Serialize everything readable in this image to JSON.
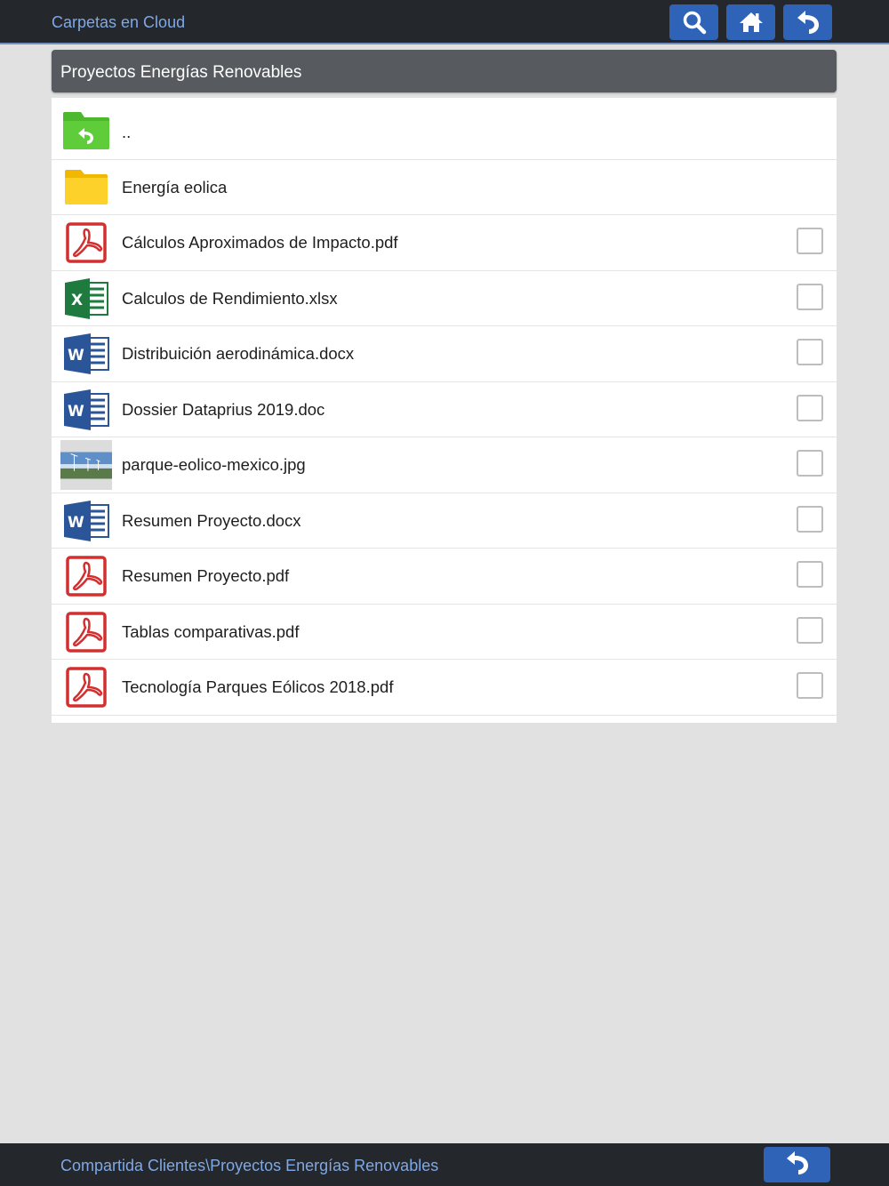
{
  "header": {
    "app_title": "Carpetas en Cloud",
    "buttons": [
      {
        "icon": "search-icon"
      },
      {
        "icon": "home-icon"
      },
      {
        "icon": "back-arrow-icon"
      }
    ]
  },
  "folder": {
    "title": "Proyectos Energías Renovables"
  },
  "files": [
    {
      "name": "..",
      "type": "parent-folder",
      "icon": "folder-up-icon",
      "checkbox": false
    },
    {
      "name": "Energía eolica",
      "type": "folder",
      "icon": "folder-icon",
      "checkbox": false
    },
    {
      "name": "Cálculos Aproximados de Impacto.pdf",
      "type": "pdf",
      "icon": "pdf-icon",
      "checkbox": true,
      "checked": false
    },
    {
      "name": "Calculos de Rendimiento.xlsx",
      "type": "xlsx",
      "icon": "excel-icon",
      "checkbox": true,
      "checked": false
    },
    {
      "name": "Distribuición aerodinámica.docx",
      "type": "docx",
      "icon": "word-icon",
      "checkbox": true,
      "checked": false
    },
    {
      "name": "Dossier Dataprius 2019.doc",
      "type": "doc",
      "icon": "word-icon",
      "checkbox": true,
      "checked": false
    },
    {
      "name": "parque-eolico-mexico.jpg",
      "type": "jpg",
      "icon": "image-thumbnail-icon",
      "checkbox": true,
      "checked": false
    },
    {
      "name": "Resumen Proyecto.docx",
      "type": "docx",
      "icon": "word-icon",
      "checkbox": true,
      "checked": false
    },
    {
      "name": "Resumen Proyecto.pdf",
      "type": "pdf",
      "icon": "pdf-icon",
      "checkbox": true,
      "checked": false
    },
    {
      "name": "Tablas comparativas.pdf",
      "type": "pdf",
      "icon": "pdf-icon",
      "checkbox": true,
      "checked": false
    },
    {
      "name": "Tecnología Parques Eólicos 2018.pdf",
      "type": "pdf",
      "icon": "pdf-icon",
      "checkbox": true,
      "checked": false
    }
  ],
  "footer": {
    "path": "Compartida Clientes\\Proyectos Energías Renovables",
    "back_icon": "back-arrow-icon"
  },
  "colors": {
    "topbar_bg": "#24272b",
    "accent_blue": "#2f63b8",
    "link_blue": "#7fa8e6",
    "folder_header_bg": "#575a5e",
    "page_bg": "#e1e1e1"
  }
}
